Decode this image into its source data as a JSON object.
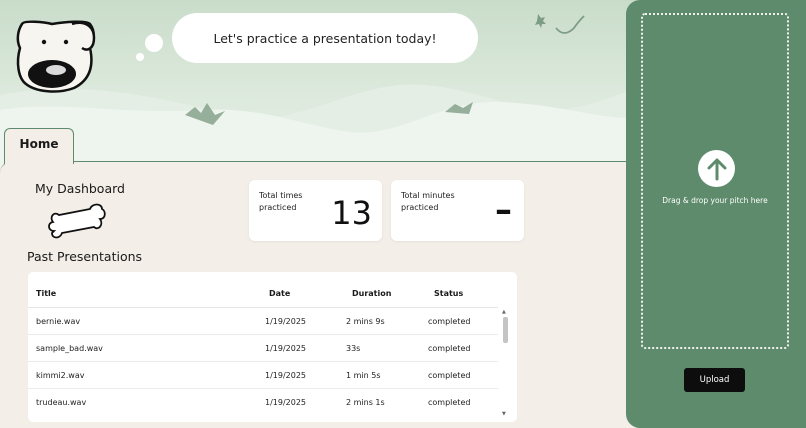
{
  "header": {
    "speech": "Let's practice a presentation today!"
  },
  "tabs": {
    "home": "Home"
  },
  "dashboard": {
    "title": "My Dashboard",
    "stats": {
      "times_label": "Total times practiced",
      "times_value": "13",
      "minutes_label": "Total minutes practiced",
      "minutes_value": "–"
    }
  },
  "past": {
    "title": "Past Presentations",
    "columns": [
      "Title",
      "Date",
      "Duration",
      "Status"
    ],
    "rows": [
      [
        "bernie.wav",
        "1/19/2025",
        "2 mins 9s",
        "completed"
      ],
      [
        "sample_bad.wav",
        "1/19/2025",
        "33s",
        "completed"
      ],
      [
        "kimmi2.wav",
        "1/19/2025",
        "1 min 5s",
        "completed"
      ],
      [
        "trudeau.wav",
        "1/19/2025",
        "2 mins 1s",
        "completed"
      ]
    ]
  },
  "upload": {
    "drop_text": "Drag & drop your pitch here",
    "button": "Upload"
  },
  "icons": {
    "mascot": "dog-icon",
    "bone": "bone-icon",
    "upload": "arrow-up-icon"
  },
  "colors": {
    "accent_green": "#5e8b6b",
    "background": "#f3efe8",
    "button": "#0d0d0d"
  }
}
